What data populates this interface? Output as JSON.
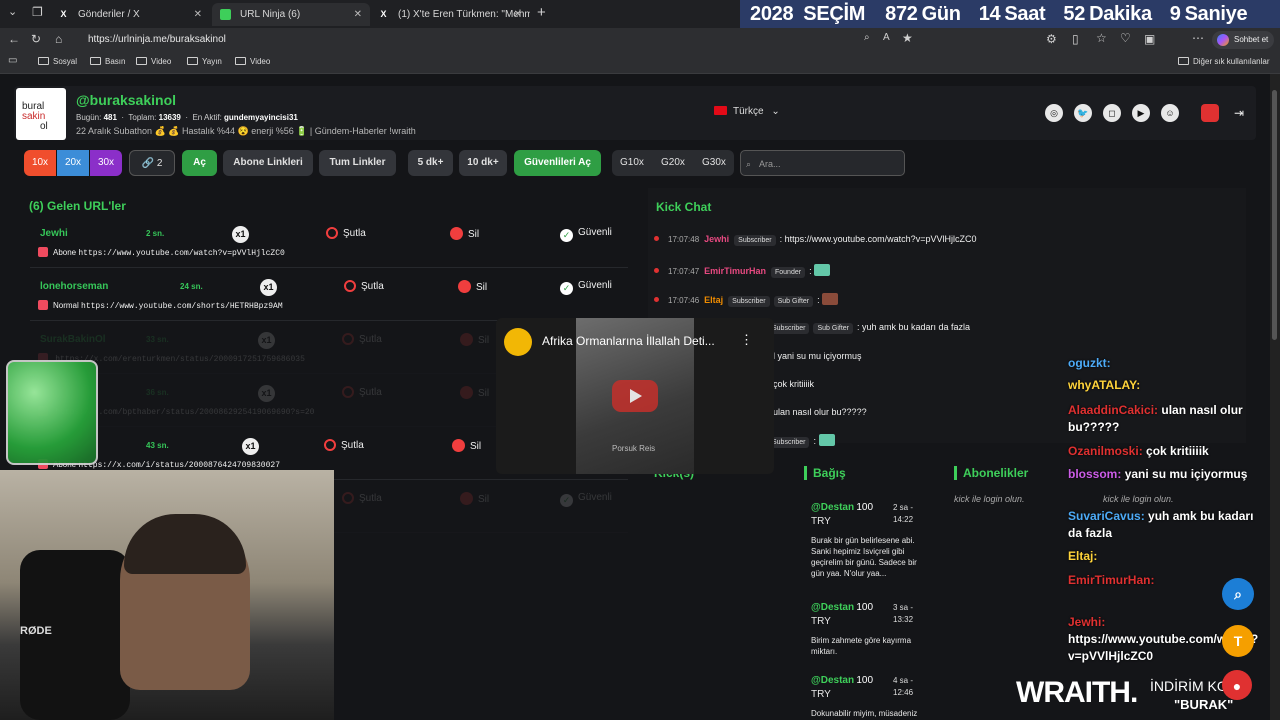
{
  "browser": {
    "tabs": [
      {
        "label": "Gönderiler / X",
        "icon": "X"
      },
      {
        "label": "URL Ninja (6)",
        "icon": ""
      },
      {
        "label": "(1) X'te Eren Türkmen: \"Mehmet A",
        "icon": "X"
      }
    ],
    "url": "https://urlninja.me/buraksakinol",
    "profile_button": "Sohbet et",
    "bookmarks": [
      "Sosyal",
      "Basın",
      "Video",
      "Yayın",
      "Video"
    ],
    "other_bookmarks": "Diğer sık kullanılanlar"
  },
  "countdown": {
    "year": "2028",
    "label": "SEÇİM",
    "days": "872",
    "days_unit": "Gün",
    "hours": "14",
    "hours_unit": "Saat",
    "minutes": "52",
    "minutes_unit": "Dakika",
    "seconds": "9",
    "seconds_unit": "Saniye"
  },
  "header": {
    "logo_lines": [
      "bural",
      "sakin",
      "ol"
    ],
    "username": "@buraksakinol",
    "today_label": "Bugün:",
    "today": "481",
    "total_label": "Toplam:",
    "total": "13639",
    "active_label": "En Aktif:",
    "active": "gundemyayincisi31",
    "subline": "22 Aralık Subathon 💰 💰 Hastalık %44 😵 enerji %56 🔋 | Gündem-Haberler !wraith",
    "language": "Türkçe"
  },
  "toolbar": {
    "speeds": [
      "10x",
      "20x",
      "30x"
    ],
    "link_count": "2",
    "open": "Aç",
    "subscriber_links": "Abone Linkleri",
    "all_links": "Tum Linkler",
    "five_min": "5 dk+",
    "ten_min": "10 dk+",
    "open_safe": "Güvenlileri Aç",
    "g10": "G10x",
    "g20": "G20x",
    "g30": "G30x",
    "search_placeholder": "Ara..."
  },
  "incoming": {
    "title": "(6) Gelen URL'ler",
    "skip": "Şutla",
    "delete": "Sil",
    "safe": "Güvenli",
    "mult": "x1",
    "rows": [
      {
        "name": "Jewhi",
        "time": "2 sn.",
        "type": "Abone",
        "url": "https://www.youtube.com/watch?v=pVVlHjlcZC0"
      },
      {
        "name": "lonehorseman",
        "time": "24 sn.",
        "type": "Normal",
        "url": "https://www.youtube.com/shorts/HETRHBpz9AM"
      },
      {
        "name": "SurakBakinOl",
        "time": "33 sn.",
        "type": "",
        "url": "https://x.com/erenturkmen/status/2000917251759686035"
      },
      {
        "name": "",
        "time": "36 sn.",
        "type": "",
        "url": "https://x.com/bpthaber/status/2000862925419069690?s=20"
      },
      {
        "name": "",
        "time": "43 sn.",
        "type": "Abone",
        "url": "https://x.com/i/status/2000876424709830027"
      },
      {
        "name": "",
        "time": "",
        "type": "",
        "url": ""
      }
    ]
  },
  "kick": {
    "title": "Kick Chat",
    "messages": [
      {
        "ts": "17:07:48",
        "user": "Jewhi",
        "color": "#e64980",
        "badges": [
          "Subscriber"
        ],
        "text": ": https://www.youtube.com/watch?v=pVVlHjlcZC0"
      },
      {
        "ts": "17:07:47",
        "user": "EmirTimurHan",
        "color": "#e64980",
        "badges": [
          "Founder"
        ],
        "text": ":"
      },
      {
        "ts": "17:07:46",
        "user": "Eltaj",
        "color": "#f08c00",
        "badges": [
          "Subscriber",
          "Sub Gifter"
        ],
        "text": ":"
      },
      {
        "ts": "",
        "user": "",
        "color": "#fff",
        "badges": [
          "Subscriber",
          "Sub Gifter"
        ],
        "text": ": yuh amk bu kadarı da fazla"
      },
      {
        "ts": "",
        "user": "",
        "color": "#fff",
        "badges": [],
        "text": "al yani su mu içiyormuş"
      },
      {
        "ts": "",
        "user": "",
        "color": "#fff",
        "badges": [],
        "text": ": çok kritiiiik"
      },
      {
        "ts": "",
        "user": "",
        "color": "#fff",
        "badges": [],
        "text": ": ulan nasıl olur bu?????"
      },
      {
        "ts": "",
        "user": "",
        "color": "#fff",
        "badges": [
          "Subscriber"
        ],
        "text": ":"
      }
    ]
  },
  "lower": {
    "kicks_title": "Kick(s)",
    "donations_title": "Bağış",
    "subs_title": "Abonelikler",
    "login_hint": "kick ile login olun.",
    "donations": [
      {
        "name": "@Destan",
        "amount": "100",
        "cur": "TRY",
        "date": "2 sa -",
        "time": "14:22",
        "text": "Burak bir gün belirlesene abi. Sanki hepimiz Isviçreli gibi geçirelim bir günü. Sadece bir gün yaa. N'olur yaa..."
      },
      {
        "name": "@Destan",
        "amount": "100",
        "cur": "TRY",
        "date": "3 sa -",
        "time": "13:32",
        "text": "Birim zahmete göre kayırma miktarı."
      },
      {
        "name": "@Destan",
        "amount": "100",
        "cur": "TRY",
        "date": "4 sa -",
        "time": "12:46",
        "text": "Dokunabilir miyim, müsadeniz"
      }
    ]
  },
  "overlay_chat": [
    {
      "user": "oguzkt:",
      "color": "#4dabf7",
      "text": ""
    },
    {
      "user": "whyATALAY:",
      "color": "#ffd43b",
      "text": ""
    },
    {
      "user": "AlaaddinCakici:",
      "color": "#e03131",
      "text": "ulan nasıl olur bu?????"
    },
    {
      "user": "Ozanilmoski:",
      "color": "#e03131",
      "text": "çok kritiiiik"
    },
    {
      "user": "blossom:",
      "color": "#cc5de8",
      "text": "yani su mu içiyormuş"
    },
    {
      "user": "SuvariCavus:",
      "color": "#4dabf7",
      "text": "yuh amk bu kadarı da fazla"
    },
    {
      "user": "Eltaj:",
      "color": "#ffd43b",
      "text": ""
    },
    {
      "user": "EmirTimurHan:",
      "color": "#e03131",
      "text": ""
    },
    {
      "user": "Jewhi:",
      "color": "#e03131",
      "text": "https://www.youtube.com/watch?v=pVVlHjlcZC0"
    }
  ],
  "popup": {
    "title": "Afrika Ormanlarına İllallah Deti...",
    "caption": "Porsuk Reis"
  },
  "brand": {
    "name": "WRAITH.",
    "promo": "İNDİRİM KODU:",
    "code": "\"BURAK\""
  },
  "webcam": {
    "mic_brand": "RØDE"
  },
  "fab_t": "T"
}
